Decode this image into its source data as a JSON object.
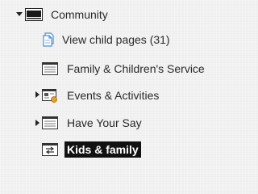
{
  "tree": {
    "root": {
      "label": "Community",
      "expanded": true,
      "icon": "page-dark-icon"
    },
    "children": [
      {
        "label": "View child pages (31)",
        "icon": "child-pages-icon",
        "has_children": false
      },
      {
        "label": "Family & Children's Service",
        "icon": "page-lines-icon",
        "has_children": false
      },
      {
        "label": "Events & Activities",
        "icon": "events-page-icon",
        "has_children": true,
        "expanded": false
      },
      {
        "label": "Have Your Say",
        "icon": "page-lines-icon",
        "has_children": true,
        "expanded": false
      },
      {
        "label": "Kids & family",
        "icon": "redirect-page-icon",
        "has_children": false,
        "selected": true
      }
    ]
  },
  "colors": {
    "selected_background": "#111111",
    "selected_text": "#ffffff",
    "text": "#2a2a2a",
    "child_pages_icon": "#4a90d9",
    "events_icon_accent": "#e8a020"
  }
}
